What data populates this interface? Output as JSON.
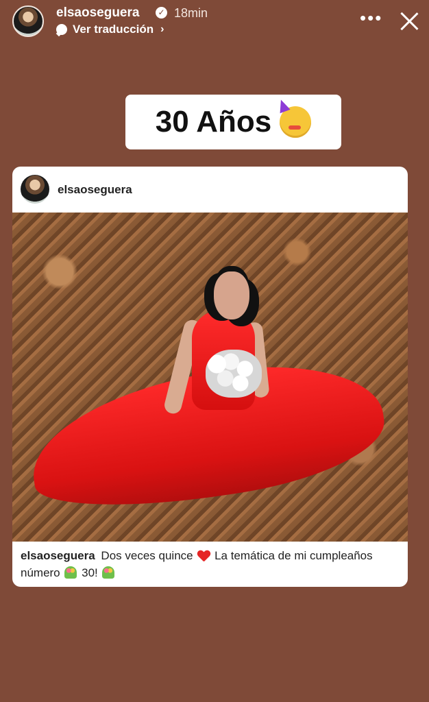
{
  "theme": {
    "background": "#7f4a38"
  },
  "story_header": {
    "username": "elsaoseguera",
    "verified": true,
    "timestamp": "18min",
    "translate_label": "Ver traducción",
    "icons": {
      "verified": "verified-badge-icon",
      "translate": "chat-bubble-icon",
      "chevron": "chevron-right-icon",
      "more": "more-options-icon",
      "close": "close-icon"
    }
  },
  "sticker": {
    "text": "30 Años",
    "emoji": "party-face-icon"
  },
  "post": {
    "username": "elsaoseguera",
    "caption": {
      "username": "elsaoseguera",
      "text_1": "Dos veces quince",
      "text_2": "La temática de mi cumpleaños número",
      "text_3": "30!",
      "emoji_1": "red-heart-icon",
      "emoji_2": "bouquet-icon",
      "emoji_3": "bouquet-icon"
    }
  }
}
